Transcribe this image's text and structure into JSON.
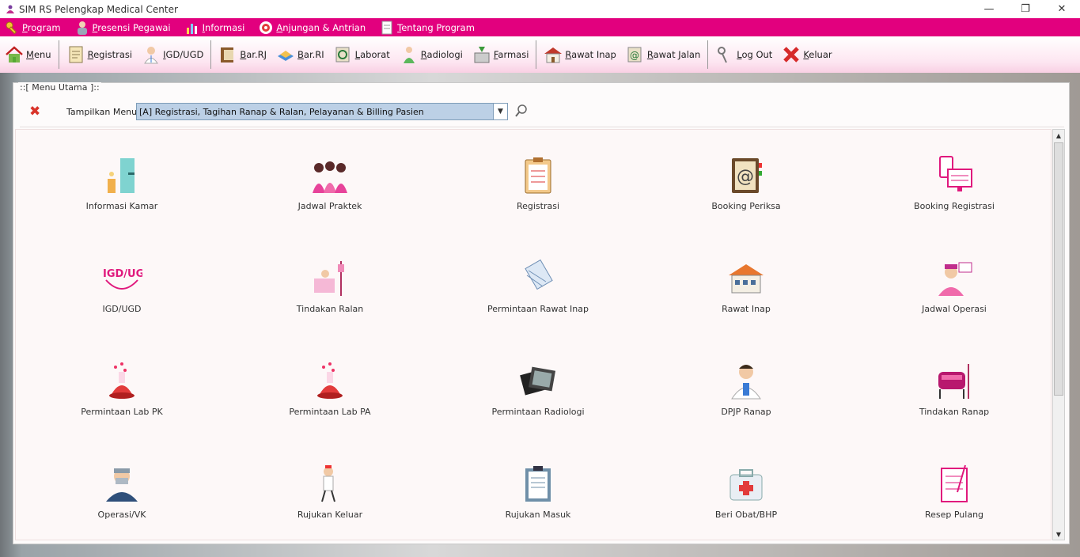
{
  "window": {
    "title": "SIM RS Pelengkap Medical Center",
    "controls": [
      "—",
      "❐",
      "✕"
    ]
  },
  "menubar": [
    {
      "label": "Program",
      "icon": "key-icon"
    },
    {
      "label": "Presensi Pegawai",
      "icon": "employee-icon"
    },
    {
      "label": "Informasi",
      "icon": "chart-icon"
    },
    {
      "label": "Anjungan & Antrian",
      "icon": "kiosk-icon"
    },
    {
      "label": "Tentang Program",
      "icon": "document-icon"
    }
  ],
  "toolbar": [
    {
      "label": "Menu",
      "icon": "home-icon"
    },
    {
      "label": "Registrasi",
      "icon": "registration-icon"
    },
    {
      "label": "IGD/UGD",
      "icon": "doctor-icon"
    },
    {
      "label": "Bar.RJ",
      "icon": "book-icon"
    },
    {
      "label": "Bar.RI",
      "icon": "tray-icon"
    },
    {
      "label": "Laborat",
      "icon": "lab-icon"
    },
    {
      "label": "Radiologi",
      "icon": "radiology-icon"
    },
    {
      "label": "Farmasi",
      "icon": "pharmacy-icon"
    },
    {
      "label": "Rawat Inap",
      "icon": "hospital-icon"
    },
    {
      "label": "Rawat Jalan",
      "icon": "outpatient-icon"
    },
    {
      "label": "Log Out",
      "icon": "keys-icon"
    },
    {
      "label": "Keluar",
      "icon": "exit-icon"
    }
  ],
  "panel": {
    "legend": "::[ Menu Utama ]::",
    "tampilkan_label": "Tampilkan Menu :",
    "selected_menu": "[A] Registrasi, Tagihan Ranap & Ralan, Pelayanan & Billing Pasien"
  },
  "tiles": [
    {
      "label": "Informasi Kamar",
      "icon": "room-info-icon"
    },
    {
      "label": "Jadwal Praktek",
      "icon": "nurses-icon"
    },
    {
      "label": "Registrasi",
      "icon": "clipboard-icon"
    },
    {
      "label": "Booking Periksa",
      "icon": "address-book-icon"
    },
    {
      "label": "Booking Registrasi",
      "icon": "devices-icon"
    },
    {
      "label": "IGD/UGD",
      "icon": "igd-icon"
    },
    {
      "label": "Tindakan Ralan",
      "icon": "patient-bed-icon"
    },
    {
      "label": "Permintaan Rawat Inap",
      "icon": "pages-icon"
    },
    {
      "label": "Rawat Inap",
      "icon": "building-icon"
    },
    {
      "label": "Jadwal Operasi",
      "icon": "surgeon-icon"
    },
    {
      "label": "Permintaan Lab PK",
      "icon": "flask-icon"
    },
    {
      "label": "Permintaan Lab PA",
      "icon": "flask-icon"
    },
    {
      "label": "Permintaan Radiologi",
      "icon": "xray-icon"
    },
    {
      "label": "DPJP Ranap",
      "icon": "doctor-icon"
    },
    {
      "label": "Tindakan Ranap",
      "icon": "hospital-bed-icon"
    },
    {
      "label": "Operasi/VK",
      "icon": "masked-surgeon-icon"
    },
    {
      "label": "Rujukan Keluar",
      "icon": "nurse-walking-icon"
    },
    {
      "label": "Rujukan Masuk",
      "icon": "form-icon"
    },
    {
      "label": "Beri Obat/BHP",
      "icon": "first-aid-icon"
    },
    {
      "label": "Resep Pulang",
      "icon": "prescription-icon"
    }
  ],
  "colors": {
    "menubar": "#e2007e",
    "accent_pink": "#e0197d",
    "select_bg": "#bcd0e6"
  }
}
